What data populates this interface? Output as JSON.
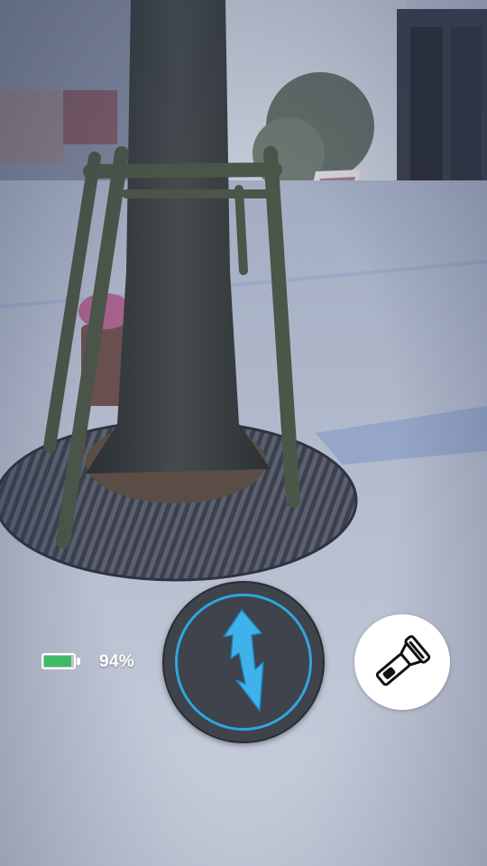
{
  "app": {
    "battery": {
      "percent_label": "94%",
      "level": 0.94,
      "fill_color": "#3fba62"
    },
    "power_button": {
      "icon": "lightning-bolt-icon",
      "ring_color": "#2fa6e0",
      "bolt_color": "#3fb2ea"
    },
    "torch_button": {
      "icon": "flashlight-icon"
    }
  }
}
